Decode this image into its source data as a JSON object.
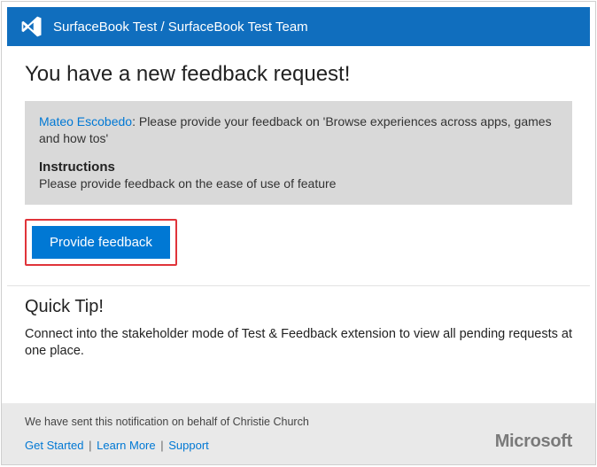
{
  "header": {
    "breadcrumb": "SurfaceBook Test / SurfaceBook Test Team"
  },
  "main": {
    "title": "You have a new feedback request!",
    "request": {
      "requester_name": "Mateo Escobedo",
      "message": ": Please provide your feedback on 'Browse experiences across  apps, games and how tos'",
      "instructions_label": "Instructions",
      "instructions_body": "Please provide feedback on the ease of use of feature"
    },
    "cta_label": "Provide feedback"
  },
  "tip": {
    "title": "Quick Tip!",
    "body": "Connect into the stakeholder mode of Test & Feedback extension to view all pending requests at one place."
  },
  "footer": {
    "note_prefix": "We have sent this notification on behalf of ",
    "sender": "Christie Church",
    "links": {
      "get_started": "Get Started",
      "learn_more": "Learn More",
      "support": "Support"
    },
    "brand": "Microsoft"
  }
}
